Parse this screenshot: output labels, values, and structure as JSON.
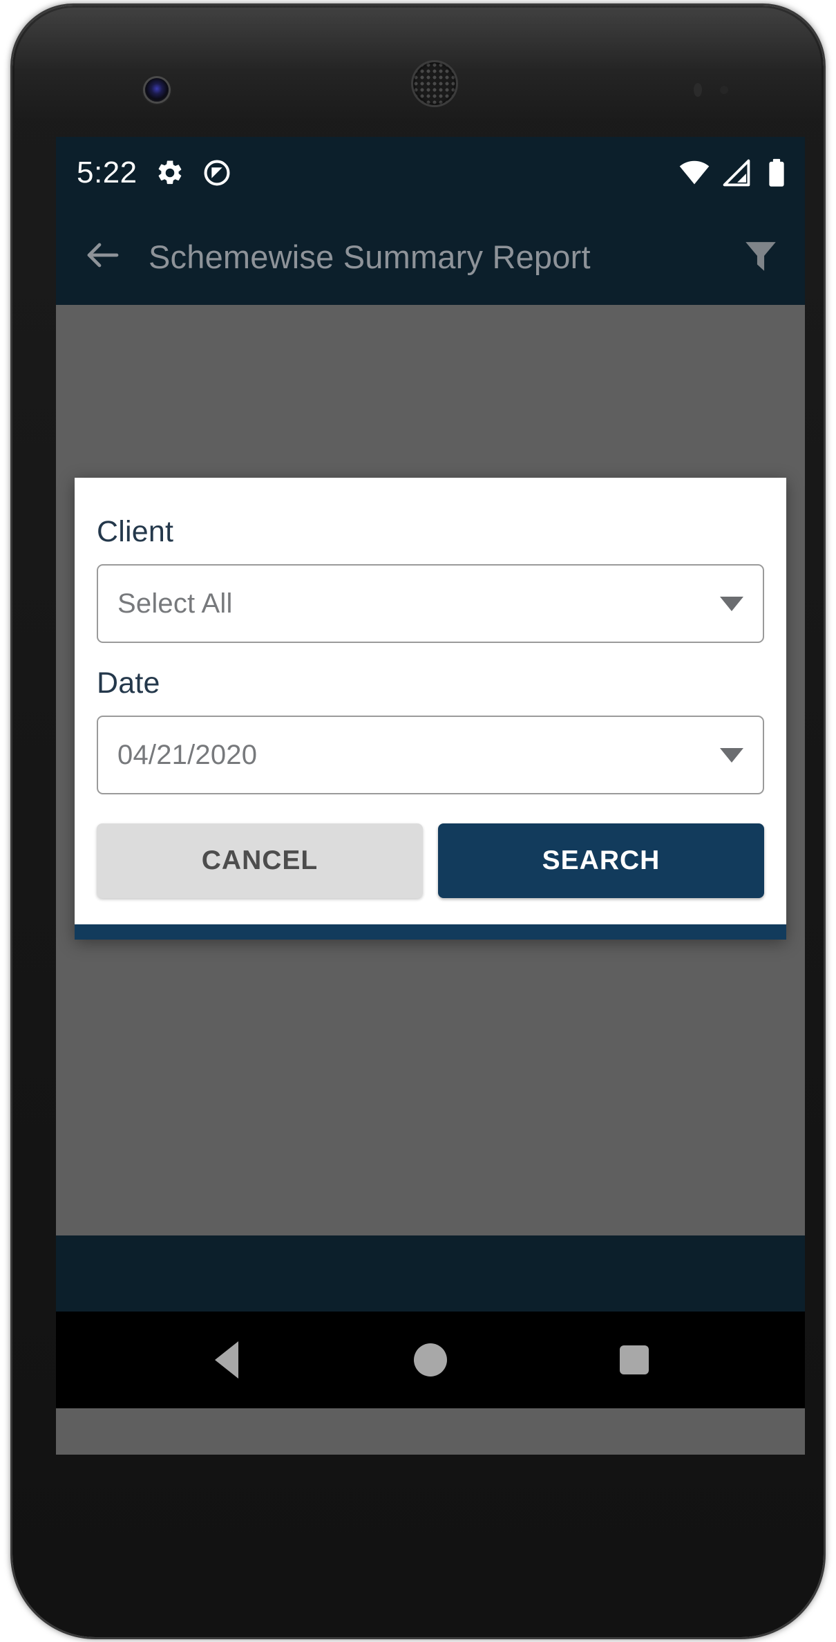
{
  "status_bar": {
    "time": "5:22",
    "icons_left": [
      "gear-icon",
      "do-not-disturb-icon"
    ],
    "icons_right": [
      "wifi-icon",
      "cellular-signal-icon",
      "battery-full-icon"
    ],
    "background_color": "#0c1f2b"
  },
  "app_bar": {
    "back_icon": "arrow-back-icon",
    "title": "Schemewise Summary Report",
    "filter_icon": "filter-funnel-icon",
    "background_color": "#0c1f2b",
    "title_color": "#8e9399"
  },
  "dialog": {
    "fields": [
      {
        "label": "Client",
        "value": "Select All",
        "caret_icon": "chevron-down-icon"
      },
      {
        "label": "Date",
        "value": "04/21/2020",
        "caret_icon": "chevron-down-icon"
      }
    ],
    "buttons": {
      "cancel_label": "CANCEL",
      "search_label": "SEARCH"
    },
    "accent_color": "#123b5c",
    "label_color": "#24384b",
    "value_color": "#77797c",
    "cancel_bg": "#dcdcdc",
    "search_bg": "#123b5c"
  },
  "nav_bar": {
    "back": "nav-back-icon",
    "home": "nav-home-icon",
    "recents": "nav-recents-icon",
    "background_color": "#000000"
  },
  "scrim_color": "#5f5f5f"
}
